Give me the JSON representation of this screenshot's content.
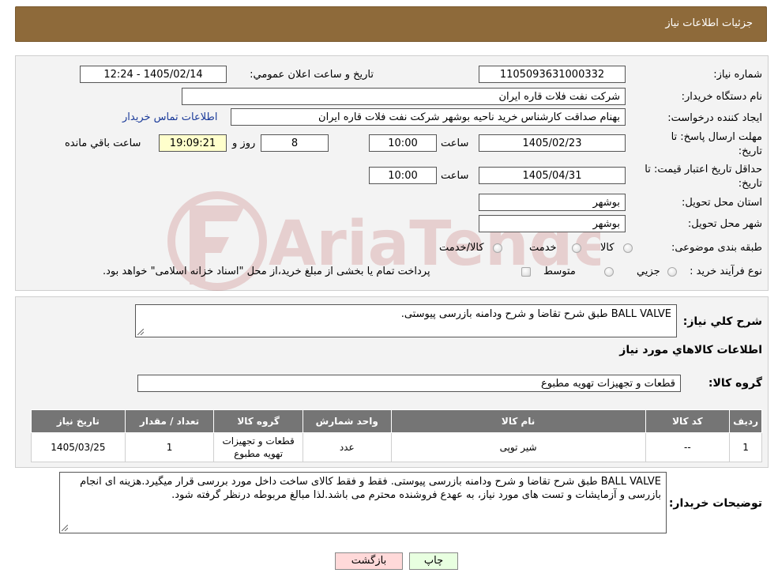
{
  "header": {
    "title": "جزئیات اطلاعات نیاز"
  },
  "form": {
    "need_number_label": "شماره نیاز:",
    "need_number": "1105093631000332",
    "announce_label": "تاریخ و ساعت اعلان عمومي:",
    "announce_value": "1405/02/14 - 12:24",
    "buyer_org_label": "نام دستگاه خريدار:",
    "buyer_org": "شرکت نفت فلات قاره ایران",
    "creator_label": "ايجاد كننده درخواست:",
    "creator": "بهنام  صداقت کارشناس خرید ناحیه بوشهر شرکت نفت فلات قاره ایران",
    "contact_link": "اطلاعات تماس خریدار",
    "deadline_label_1": "مهلت ارسال پاسخ: تا",
    "deadline_label_2": "تاریخ:",
    "deadline_date": "1405/02/23",
    "time_label": "ساعت",
    "deadline_time": "10:00",
    "days": "8",
    "days_label": "روز و",
    "remaining_time": "19:09:21",
    "remaining_label": "ساعت باقي مانده",
    "validity_label_1": "حداقل تاریخ اعتبار قیمت: تا",
    "validity_label_2": "تاریخ:",
    "validity_date": "1405/04/31",
    "validity_time": "10:00",
    "province_label": "استان محل تحويل:",
    "province": "بوشهر",
    "city_label": "شهر محل تحويل:",
    "city": "بوشهر",
    "category_label": "طبقه بندی موضوعی:",
    "category_options": [
      "كالا",
      "خدمت",
      "كالا/خدمت"
    ],
    "process_label": "نوع فرآيند خريد :",
    "process_options": [
      "جزيي",
      "متوسط"
    ],
    "process_note": "پرداخت تمام یا بخشی از مبلغ خرید،از محل \"اسناد خزانه اسلامی\" خواهد بود."
  },
  "description": {
    "label": "شرح كلي نياز:",
    "text": "BALL VALVE طبق شرح تقاضا و شرح ودامنه بازرسی پیوستی."
  },
  "goods": {
    "section_title": "اطلاعات كالاهاي مورد نياز",
    "group_label": "گروه كالا:",
    "group_value": "قطعات و تجهیزات تهویه مطبوع",
    "columns": [
      "رديف",
      "كد كالا",
      "نام كالا",
      "واحد شمارش",
      "گروه كالا",
      "تعداد / مقدار",
      "تاريخ نياز"
    ],
    "rows": [
      {
        "row": "1",
        "code": "--",
        "name": "شیر توپی",
        "unit": "عدد",
        "group": "قطعات و تجهیزات تهویه مطبوع",
        "qty": "1",
        "date": "1405/03/25"
      }
    ]
  },
  "buyer_notes": {
    "label": "توضيحات خريدار:",
    "text": "BALL VALVE طبق شرح تقاضا و شرح ودامنه بازرسی پیوستی. فقط و فقط کالای ساخت داخل مورد بررسی قرار میگیرد.هزینه ای انجام بازرسی و آزمایشات و تست های مورد نیاز، به عهدع فروشنده محترم می باشد.لذا مبالغ مربوطه درنظر گرفته شود."
  },
  "buttons": {
    "print": "چاپ",
    "back": "بازگشت"
  },
  "watermark": {
    "text": "AriaTender.neT"
  },
  "colors": {
    "header": "#8e6a3a",
    "table_header": "#757575",
    "back_button": "#ffd9d9",
    "print_button": "#e8ffe0",
    "link": "#1a3a99"
  }
}
